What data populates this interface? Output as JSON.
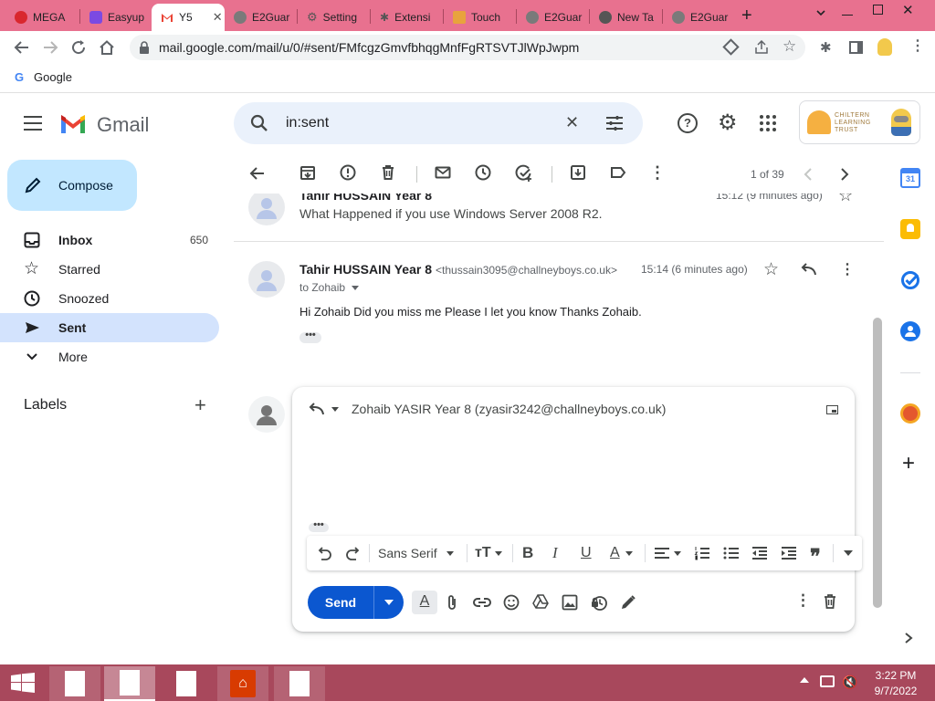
{
  "browser": {
    "tabs": [
      {
        "label": "MEGA",
        "color": "#d9272e"
      },
      {
        "label": "Easyup",
        "color": "#7b4ae2"
      },
      {
        "label": "Y5",
        "color": "#ea4335"
      },
      {
        "label": "E2Guar",
        "color": "#6b6b6b"
      },
      {
        "label": "Setting",
        "color": "#6b6b6b"
      },
      {
        "label": "Extensi",
        "color": "#6b6b6b"
      },
      {
        "label": "Touch",
        "color": "#e8a33d"
      },
      {
        "label": "E2Guar",
        "color": "#6b6b6b"
      },
      {
        "label": "New Ta",
        "color": "#6b6b6b"
      },
      {
        "label": "E2Guar",
        "color": "#6b6b6b"
      }
    ],
    "url": "mail.google.com/mail/u/0/#sent/FMfcgzGmvfbhqgMnfFgRTSVTJlWpJwpm",
    "bookmark": "Google"
  },
  "gmail": {
    "logo_text": "Gmail",
    "compose_label": "Compose",
    "search_value": "in:sent",
    "nav": [
      {
        "label": "Inbox",
        "count": "650",
        "icon": "inbox-icon"
      },
      {
        "label": "Starred",
        "count": "",
        "icon": "star-icon"
      },
      {
        "label": "Snoozed",
        "count": "",
        "icon": "clock-icon"
      },
      {
        "label": "Sent",
        "count": "",
        "icon": "send-icon"
      },
      {
        "label": "More",
        "count": "",
        "icon": "chevron-down-icon"
      }
    ],
    "labels_title": "Labels",
    "org_logo": "CHILTERN LEARNING TRUST",
    "pager": "1 of 39",
    "messages": [
      {
        "sender": "Tahir HUSSAIN Year 8",
        "snippet": "What Happened if you use Windows Server 2008 R2.",
        "time": "15:12 (9 minutes ago)"
      },
      {
        "sender": "Tahir HUSSAIN Year 8",
        "email": "<thussain3095@challneyboys.co.uk>",
        "time": "15:14 (6 minutes ago)",
        "to": "to Zohaib",
        "body": "Hi Zohaib Did you miss me Please I let you know Thanks Zohaib."
      }
    ],
    "reply": {
      "recipient": "Zohaib YASIR Year 8 (zyasir3242@challneyboys.co.uk)",
      "font": "Sans Serif",
      "send_label": "Send"
    }
  },
  "taskbar": {
    "time": "3:22 PM",
    "date": "9/7/2022"
  },
  "colors": {
    "tabstrip": "#e8718f",
    "taskbar": "#a8485c",
    "accent": "#0b57d0",
    "compose_bg": "#c2e7ff",
    "nav_selected": "#d3e3fd"
  }
}
